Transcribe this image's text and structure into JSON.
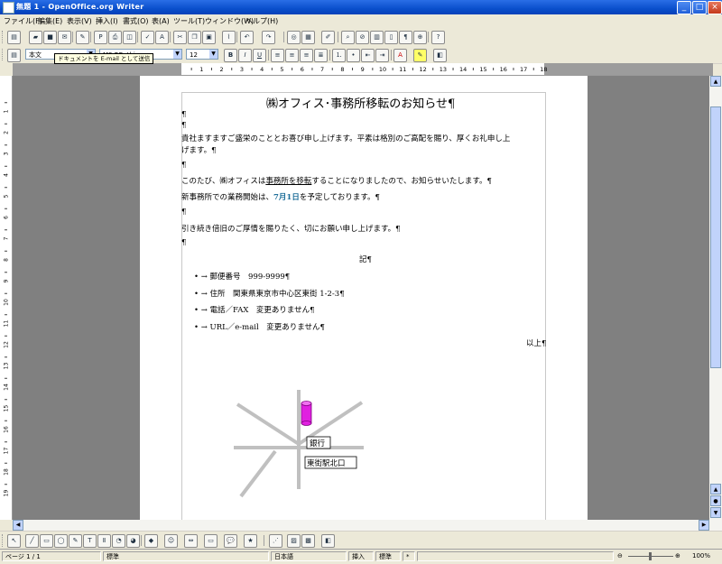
{
  "window": {
    "title": "無題 1 - OpenOffice.org Writer"
  },
  "menu": [
    "ファイル(F)",
    "編集(E)",
    "表示(V)",
    "挿入(I)",
    "書式(O)",
    "表(A)",
    "ツール(T)",
    "ウィンドウ(W)",
    "ヘルプ(H)"
  ],
  "format_bar": {
    "style": "本文",
    "font": "MS PGothic",
    "size": "12",
    "tooltip": "ドキュメントを E-mail として送信"
  },
  "ruler_numbers": [
    "1",
    "2",
    "3",
    "4",
    "5",
    "6",
    "7",
    "8",
    "9",
    "10",
    "11",
    "12",
    "13",
    "14",
    "15",
    "16",
    "17",
    "18"
  ],
  "vruler_numbers": [
    "1",
    "2",
    "3",
    "4",
    "5",
    "6",
    "7",
    "8",
    "9",
    "10",
    "11",
    "12",
    "13",
    "14",
    "15",
    "16",
    "17",
    "18",
    "19"
  ],
  "document": {
    "title": "㈱オフィス･事務所移転のお知らせ¶",
    "pilcrow": "¶",
    "para1_line1": "貴社ますますご盛栄のこととお喜び申し上げます。平素は格別のご高配を賜り、厚くお礼申し上",
    "para1_line2": "げます。¶",
    "para2_before": "このたび、㈱オフィスは",
    "para2_link": "事務所を移転",
    "para2_after": "することになりましたので、お知らせいたします。¶",
    "para3_before": "新事務所での業務開始は、",
    "para3_date": "7月1日",
    "para3_after": "を予定しております。¶",
    "para4": "引き続き倍旧のご厚情を賜りたく、切にお願い申し上げます。¶",
    "ki": "記¶",
    "bullets": [
      "• → 郵便番号　999-9999¶",
      "• → 住所　関東県東京市中心区東街 1-2-3¶",
      "• → 電話／FAX　変更ありません¶",
      "• → URL／e-mail　変更ありません¶"
    ],
    "ijou": "以上¶",
    "map": {
      "bank": "銀行",
      "station": "東街駅北口"
    }
  },
  "status": {
    "page": "ページ 1 / 1",
    "style": "標準",
    "language": "日本語",
    "insert": "挿入",
    "selection": "標準",
    "zoom": "100%"
  },
  "colors": {
    "accent": "#0a4fcc",
    "date": "#1f6f9a",
    "map_pin": "#e020e0"
  }
}
